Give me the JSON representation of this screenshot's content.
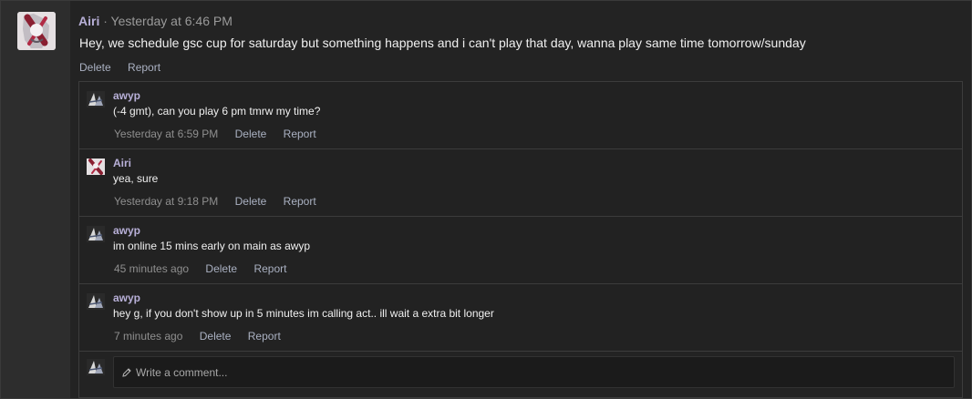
{
  "post": {
    "author": "Airi",
    "separator": "·",
    "timestamp": "Yesterday at 6:46 PM",
    "text": "Hey, we schedule gsc cup for saturday but something happens and i can't play that day, wanna play same time tomorrow/sunday",
    "actions": [
      "Delete",
      "Report"
    ]
  },
  "comments": [
    {
      "author": "awyp",
      "text": "(-4 gmt), can you play 6 pm tmrw my time?",
      "timestamp": "Yesterday at 6:59 PM",
      "actions": [
        "Delete",
        "Report"
      ]
    },
    {
      "author": "Airi",
      "text": "yea, sure",
      "timestamp": "Yesterday at 9:18 PM",
      "actions": [
        "Delete",
        "Report"
      ]
    },
    {
      "author": "awyp",
      "text": "im online 15 mins early on main as awyp",
      "timestamp": "45 minutes ago",
      "actions": [
        "Delete",
        "Report"
      ]
    },
    {
      "author": "awyp",
      "text": "hey g, if you don't show up in 5 minutes im calling act.. ill wait a extra bit longer",
      "timestamp": "7 minutes ago",
      "actions": [
        "Delete",
        "Report"
      ]
    }
  ],
  "compose": {
    "placeholder": "Write a comment..."
  },
  "icons": {
    "airi_avatar": "avatar-airi",
    "awyp_avatar": "avatar-awyp",
    "pencil": "pencil-icon"
  }
}
